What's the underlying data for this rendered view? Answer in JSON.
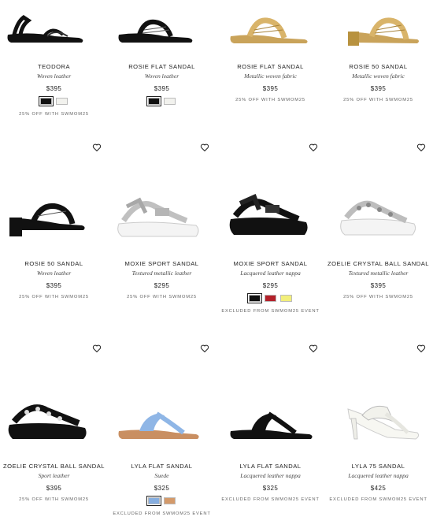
{
  "products": [
    {
      "name": "TEODORA",
      "material": "Woven leather",
      "price": "$395",
      "promo": "25% OFF WITH SWMOM25",
      "swatches": [
        "#111111",
        "#f2f2ee"
      ],
      "icon": "sandal-black-slingback"
    },
    {
      "name": "ROSIE FLAT SANDAL",
      "material": "Woven leather",
      "price": "$395",
      "promo": "",
      "swatches": [
        "#111111",
        "#f2f2ee"
      ],
      "icon": "sandal-black-flat-woven"
    },
    {
      "name": "ROSIE FLAT SANDAL",
      "material": "Metallic woven fabric",
      "price": "$395",
      "promo": "25% OFF WITH SWMOM25",
      "swatches": [],
      "icon": "sandal-gold-flat-woven"
    },
    {
      "name": "ROSIE 50 SANDAL",
      "material": "Metallic woven fabric",
      "price": "$395",
      "promo": "25% OFF WITH SWMOM25",
      "swatches": [],
      "icon": "sandal-gold-block-heel"
    },
    {
      "name": "ROSIE 50 SANDAL",
      "material": "Woven leather",
      "price": "$395",
      "promo": "25% OFF WITH SWMOM25",
      "swatches": [],
      "icon": "sandal-black-block-heel"
    },
    {
      "name": "MOXIE SPORT SANDAL",
      "material": "Textured metallic leather",
      "price": "$295",
      "promo": "25% OFF WITH SWMOM25",
      "swatches": [],
      "icon": "sandal-silver-sport"
    },
    {
      "name": "MOXIE SPORT SANDAL",
      "material": "Lacquered leather nappa",
      "price": "$295",
      "promo": "EXCLUDED FROM SWMOM25 EVENT",
      "swatches": [
        "#111111",
        "#b3202a",
        "#f2ef7a"
      ],
      "icon": "sandal-black-sport"
    },
    {
      "name": "ZOELIE CRYSTAL BALL SANDAL",
      "material": "Textured metallic leather",
      "price": "$395",
      "promo": "25% OFF WITH SWMOM25",
      "swatches": [],
      "icon": "sandal-silver-crystal"
    },
    {
      "name": "ZOELIE CRYSTAL BALL SANDAL",
      "material": "Sport leather",
      "price": "$395",
      "promo": "25% OFF WITH SWMOM25",
      "swatches": [],
      "icon": "sandal-black-crystal"
    },
    {
      "name": "LYLA FLAT SANDAL",
      "material": "Suede",
      "price": "$325",
      "promo": "EXCLUDED FROM SWMOM25 EVENT",
      "swatches": [
        "#86aee0",
        "#d49a6a"
      ],
      "icon": "sandal-blue-thong"
    },
    {
      "name": "LYLA FLAT SANDAL",
      "material": "Lacquered leather nappa",
      "price": "$325",
      "promo": "EXCLUDED FROM SWMOM25 EVENT",
      "swatches": [],
      "icon": "sandal-black-thong"
    },
    {
      "name": "LYLA 75 SANDAL",
      "material": "Lacquered leather nappa",
      "price": "$425",
      "promo": "EXCLUDED FROM SWMOM25 EVENT",
      "swatches": [],
      "icon": "sandal-white-heel-thong"
    }
  ]
}
